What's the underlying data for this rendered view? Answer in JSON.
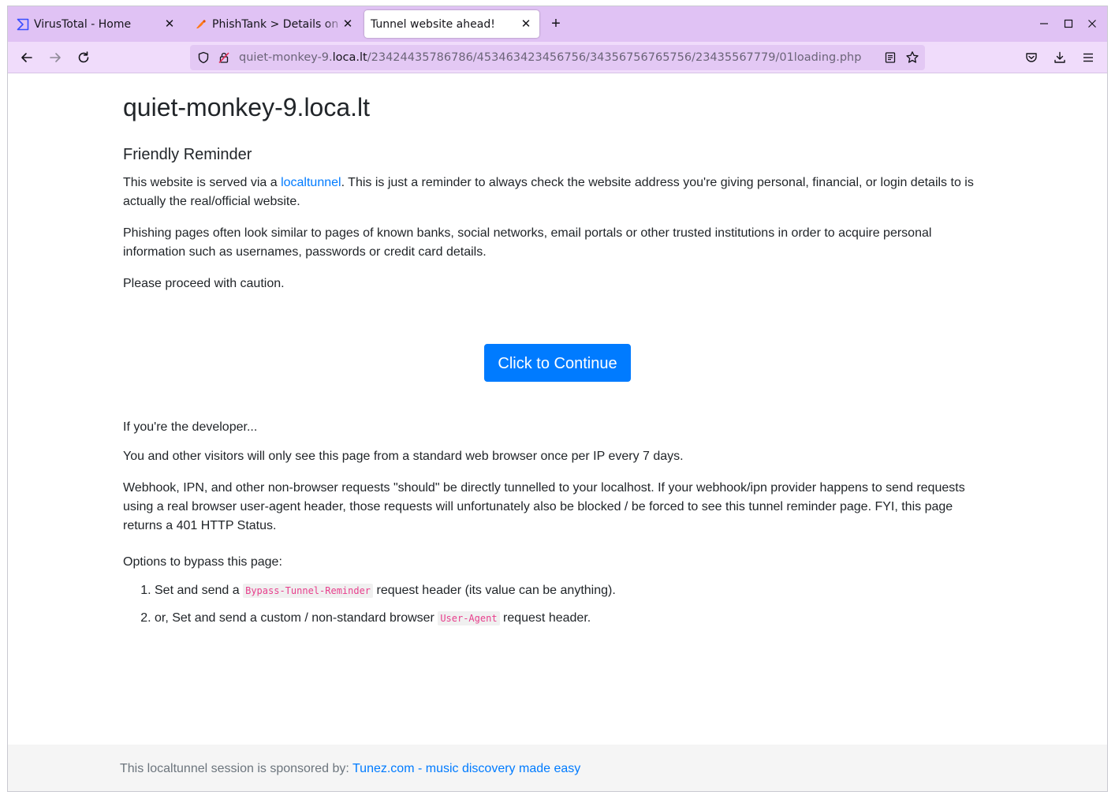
{
  "browser": {
    "tabs": [
      {
        "title": "VirusTotal - Home",
        "icon": "virustotal-icon",
        "active": false
      },
      {
        "title": "PhishTank > Details on suspected phish",
        "icon": "phishtank-icon",
        "active": false
      },
      {
        "title": "Tunnel website ahead!",
        "icon": "",
        "active": true
      }
    ],
    "url": {
      "prefix": "quiet-monkey-9.",
      "host": "loca.lt",
      "path": "/23424435786786/453463423456756/34356756765756/23435567779/01loading.php"
    },
    "colors": {
      "tabstrip": "#e0c2f4",
      "toolbar": "#f0dcfb",
      "urlbar": "#e3c8f4"
    }
  },
  "page": {
    "title": "quiet-monkey-9.loca.lt",
    "subtitle": "Friendly Reminder",
    "p1_before": "This website is served via a ",
    "p1_link": "localtunnel",
    "p1_after": ". This is just a reminder to always check the website address you're giving personal, financial, or login details to is actually the real/official website.",
    "p2": "Phishing pages often look similar to pages of known banks, social networks, email portals or other trusted institutions in order to acquire personal information such as usernames, passwords or credit card details.",
    "p3": "Please proceed with caution.",
    "continue_label": "Click to Continue",
    "dev_heading": "If you're the developer...",
    "dev_p1": "You and other visitors will only see this page from a standard web browser once per IP every 7 days.",
    "dev_p2": "Webhook, IPN, and other non-browser requests \"should\" be directly tunnelled to your localhost. If your webhook/ipn provider happens to send requests using a real browser user-agent header, those requests will unfortunately also be blocked / be forced to see this tunnel reminder page. FYI, this page returns a 401 HTTP Status.",
    "options_heading": "Options to bypass this page:",
    "options": [
      {
        "before": "Set and send a ",
        "code": "Bypass-Tunnel-Reminder",
        "after": " request header (its value can be anything)."
      },
      {
        "before": "or, Set and send a custom / non-standard browser ",
        "code": "User-Agent",
        "after": " request header."
      }
    ],
    "footer_text": "This localtunnel session is sponsored by: ",
    "footer_link": "Tunez.com - music discovery made easy",
    "colors": {
      "link": "#007bff",
      "button": "#007bff",
      "code": "#e83e8c"
    }
  }
}
